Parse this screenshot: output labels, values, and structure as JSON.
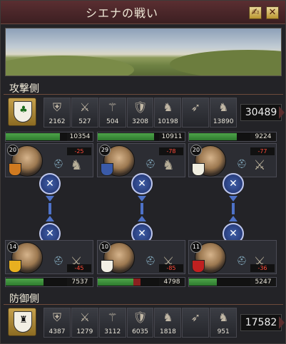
{
  "window": {
    "title": "シエナの戦い",
    "buttons": [
      {
        "icon": "info-icon",
        "glyph": "✍"
      },
      {
        "icon": "close-icon",
        "glyph": "✕"
      }
    ]
  },
  "attacker": {
    "label": "攻撃側",
    "crest_colors": {
      "field": "#f2efe4",
      "emblem": "#1a6a1a"
    },
    "units": [
      {
        "name": "light-infantry",
        "glyph": "⛨",
        "value": "2162"
      },
      {
        "name": "heavy-infantry",
        "glyph": "⚔",
        "value": "527"
      },
      {
        "name": "pikemen",
        "glyph": "⚚",
        "value": "504"
      },
      {
        "name": "light-cavalry",
        "glyph": "🛡",
        "value": "3208"
      },
      {
        "name": "heavy-cavalry",
        "glyph": "♞",
        "value": "10198"
      },
      {
        "name": "archers",
        "glyph": "➶",
        "value": ""
      },
      {
        "name": "knights",
        "glyph": "♞",
        "value": "13890"
      }
    ],
    "total": "30489",
    "commanders": [
      {
        "level": "20",
        "troops": "10354",
        "fill": 0.88,
        "loss": "-25",
        "crest": "#d07a20"
      },
      {
        "level": "29",
        "troops": "10911",
        "fill": 0.92,
        "loss": "-78",
        "crest": "#3a5aa8"
      },
      {
        "level": "20",
        "troops": "9224",
        "fill": 0.78,
        "loss": "-77",
        "crest": "#f0eee0"
      }
    ]
  },
  "defender": {
    "label": "防御側",
    "crest_colors": {
      "field": "#f2efe4",
      "emblem": "#111111"
    },
    "units": [
      {
        "name": "light-infantry",
        "glyph": "⛨",
        "value": "4387"
      },
      {
        "name": "heavy-infantry",
        "glyph": "⚔",
        "value": "1279"
      },
      {
        "name": "pikemen",
        "glyph": "⚚",
        "value": "3112"
      },
      {
        "name": "light-cavalry",
        "glyph": "🛡",
        "value": "6035"
      },
      {
        "name": "heavy-cavalry",
        "glyph": "♞",
        "value": "1818"
      },
      {
        "name": "archers",
        "glyph": "➶",
        "value": ""
      },
      {
        "name": "knights",
        "glyph": "♞",
        "value": "951"
      }
    ],
    "total": "17582",
    "commanders": [
      {
        "level": "14",
        "troops": "7537",
        "fill": 0.62,
        "loss": "-45",
        "crest": "#e8b020"
      },
      {
        "level": "10",
        "troops": "4798",
        "fill": 0.58,
        "red": 0.12,
        "loss": "-85",
        "crest": "#f2efe4"
      },
      {
        "level": "11",
        "troops": "5247",
        "fill": 0.45,
        "loss": "-36",
        "crest": "#c02020"
      }
    ]
  },
  "tactics": [
    {
      "icon": "crossed-swords-icon",
      "glyph": "✕"
    },
    {
      "icon": "crossed-swords-icon",
      "glyph": "✕"
    },
    {
      "icon": "crossed-swords-icon",
      "glyph": "✕"
    }
  ]
}
